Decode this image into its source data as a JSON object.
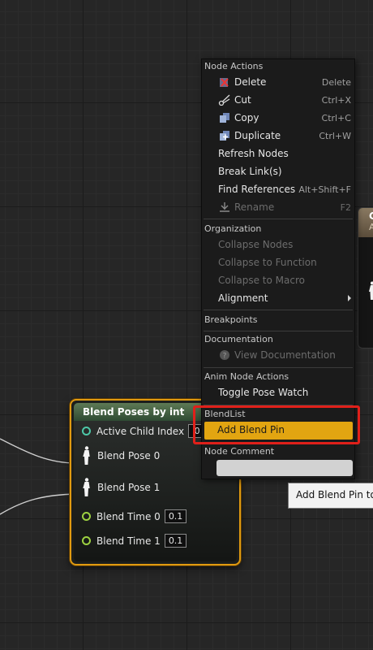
{
  "node": {
    "title": "Blend Poses by int",
    "pins": [
      {
        "label": "Active Child Index",
        "value": "0",
        "kind": "int"
      },
      {
        "label": "Blend Pose 0",
        "kind": "pose"
      },
      {
        "label": "Blend Pose 1",
        "kind": "pose"
      },
      {
        "label": "Blend Time 0",
        "value": "0.1",
        "kind": "float"
      },
      {
        "label": "Blend Time 1",
        "value": "0.1",
        "kind": "float"
      }
    ]
  },
  "right_node": {
    "title": "C",
    "subtitle": "A"
  },
  "menu": {
    "node_actions": {
      "header": "Node Actions",
      "items": [
        {
          "label": "Delete",
          "shortcut": "Delete",
          "icon": "delete-icon"
        },
        {
          "label": "Cut",
          "shortcut": "Ctrl+X",
          "icon": "scissors-icon"
        },
        {
          "label": "Copy",
          "shortcut": "Ctrl+C",
          "icon": "copy-icon"
        },
        {
          "label": "Duplicate",
          "shortcut": "Ctrl+W",
          "icon": "duplicate-icon"
        },
        {
          "label": "Refresh Nodes"
        },
        {
          "label": "Break Link(s)"
        },
        {
          "label": "Find References",
          "shortcut": "Alt+Shift+F"
        },
        {
          "label": "Rename",
          "shortcut": "F2",
          "icon": "rename-icon",
          "disabled": true
        }
      ]
    },
    "organization": {
      "header": "Organization",
      "items": [
        {
          "label": "Collapse Nodes",
          "disabled": true
        },
        {
          "label": "Collapse to Function",
          "disabled": true
        },
        {
          "label": "Collapse to Macro",
          "disabled": true
        },
        {
          "label": "Alignment",
          "submenu": true
        }
      ]
    },
    "breakpoints": {
      "header": "Breakpoints"
    },
    "documentation": {
      "header": "Documentation",
      "items": [
        {
          "label": "View Documentation",
          "icon": "help-icon",
          "disabled": true
        }
      ]
    },
    "anim_node_actions": {
      "header": "Anim Node Actions",
      "items": [
        {
          "label": "Toggle Pose Watch"
        }
      ]
    },
    "blendlist": {
      "header": "BlendList",
      "items": [
        {
          "label": "Add Blend Pin"
        }
      ]
    },
    "node_comment": {
      "header": "Node Comment",
      "value": ""
    }
  },
  "tooltip": {
    "text": "Add Blend Pin to"
  },
  "colors": {
    "accent": "#e2a511",
    "highlight_outline": "#e0201a",
    "node_border": "#e09a10"
  }
}
